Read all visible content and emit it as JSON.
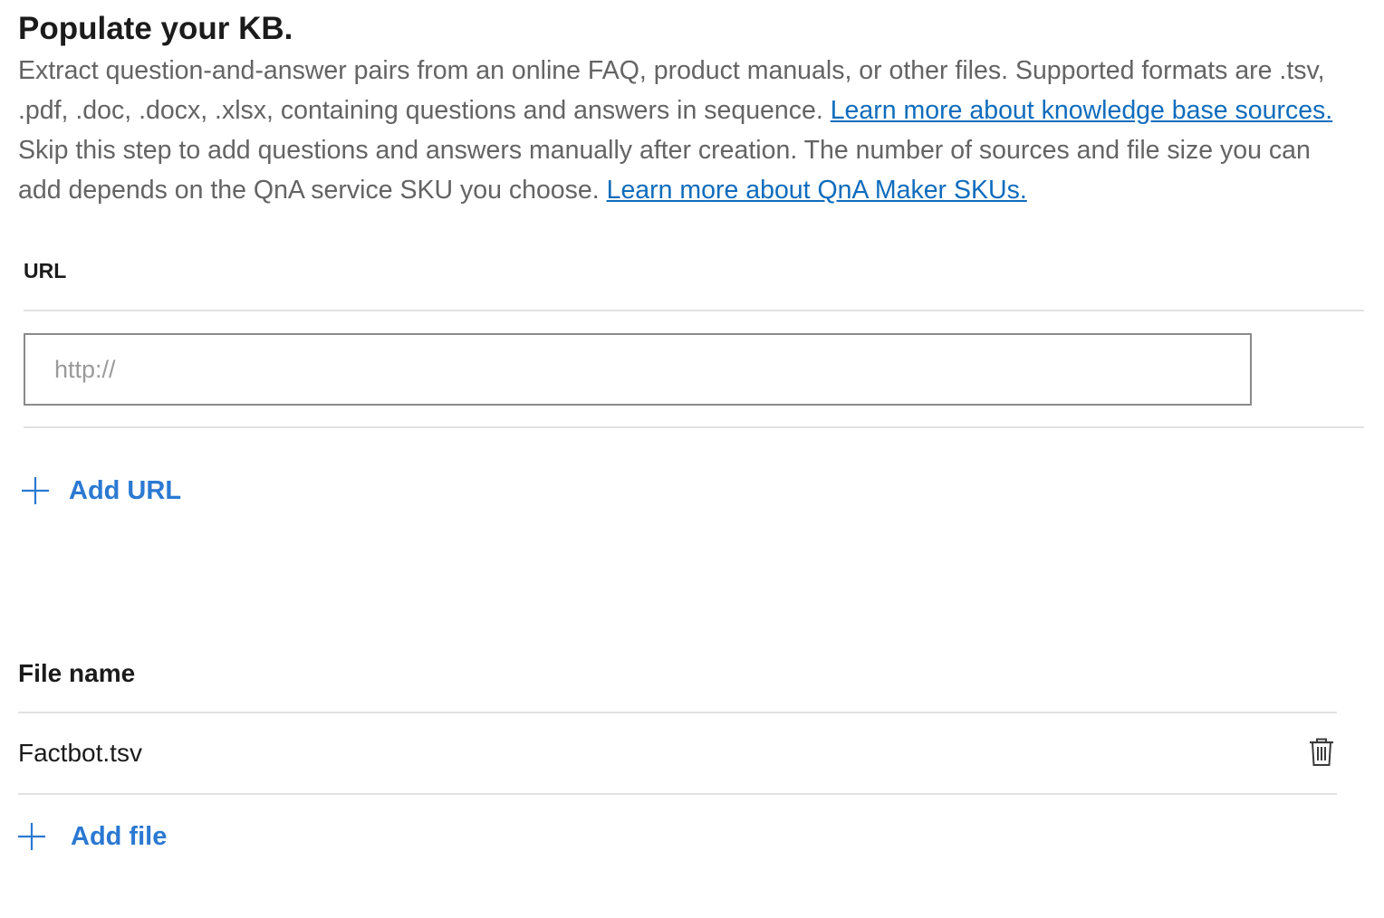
{
  "header": {
    "title": "Populate your KB."
  },
  "description": {
    "text1": "Extract question-and-answer pairs from an online FAQ, product manuals, or other files. Supported formats are .tsv, .pdf, .doc, .docx, .xlsx, containing questions and answers in sequence. ",
    "link1": "Learn more about knowledge base sources. ",
    "text2": "Skip this step to add questions and answers manually after creation. The number of sources and file size you can add depends on the QnA service SKU you choose. ",
    "link2": "Learn more about QnA Maker SKUs."
  },
  "url_section": {
    "label": "URL",
    "input_value": "",
    "input_placeholder": "http://",
    "add_label": "Add URL"
  },
  "file_section": {
    "header": "File name",
    "files": [
      {
        "name": "Factbot.tsv"
      }
    ],
    "add_label": "Add file"
  },
  "icons": {
    "add_url": "plus-icon",
    "add_file": "plus-icon",
    "delete_file": "trash-icon"
  },
  "colors": {
    "link": "#0f6cbd",
    "action": "#2b79d2",
    "body_text": "#646464",
    "heading": "#1b1b1b",
    "divider": "#e2e2e2"
  }
}
